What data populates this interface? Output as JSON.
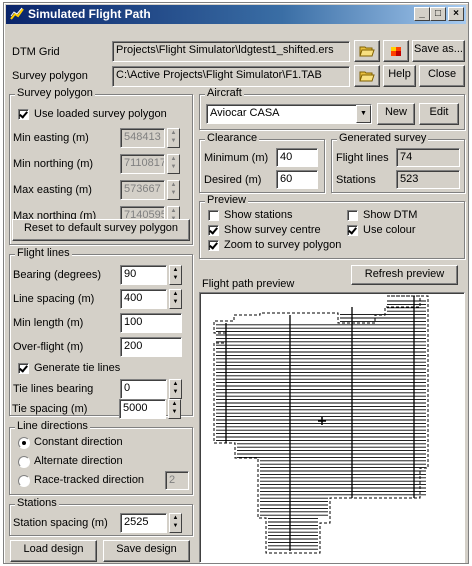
{
  "window": {
    "title": "Simulated Flight Path"
  },
  "dtm": {
    "label": "DTM Grid",
    "value": "Projects\\Flight Simulator\\ldgtest1_shifted.ers",
    "save_as": "Save as..."
  },
  "survey": {
    "label": "Survey polygon",
    "value": "C:\\Active Projects\\Flight Simulator\\F1.TAB",
    "help": "Help",
    "close": "Close"
  },
  "survey_polygon": {
    "title": "Survey polygon",
    "use_loaded": "Use loaded survey polygon",
    "min_easting_label": "Min easting (m)",
    "min_easting": "548413",
    "min_northing_label": "Min northing (m)",
    "min_northing": "7110817",
    "max_easting_label": "Max easting (m)",
    "max_easting": "573667",
    "max_northing_label": "Max northing (m)",
    "max_northing": "7140595",
    "reset": "Reset to default survey polygon"
  },
  "aircraft": {
    "title": "Aircraft",
    "selected": "Aviocar CASA",
    "new": "New",
    "edit": "Edit"
  },
  "clearance": {
    "title": "Clearance",
    "min_label": "Minimum  (m)",
    "min": "40",
    "des_label": "Desired  (m)",
    "des": "60"
  },
  "generated": {
    "title": "Generated survey",
    "lines_label": "Flight lines",
    "lines": "74",
    "stations_label": "Stations",
    "stations": "523"
  },
  "preview_opts": {
    "title": "Preview",
    "show_stations": "Show stations",
    "show_dtm": "Show DTM",
    "show_centre": "Show survey centre",
    "use_colour": "Use colour",
    "zoom": "Zoom to survey polygon"
  },
  "flight_lines": {
    "title": "Flight lines",
    "bearing_label": "Bearing (degrees)",
    "bearing": "90",
    "spacing_label": "Line spacing (m)",
    "spacing": "400",
    "minlen_label": "Min length (m)",
    "minlen": "100",
    "overflight_label": "Over-flight (m)",
    "overflight": "200",
    "tie_gen": "Generate tie lines",
    "tie_bearing_label": "Tie lines bearing",
    "tie_bearing": "0",
    "tie_spacing_label": "Tie spacing (m)",
    "tie_spacing": "5000"
  },
  "line_dir": {
    "title": "Line directions",
    "constant": "Constant direction",
    "alternate": "Alternate direction",
    "race": "Race-tracked direction",
    "race_value": "2"
  },
  "stations": {
    "title": "Stations",
    "spacing_label": "Station spacing (m)",
    "spacing": "2525"
  },
  "buttons": {
    "load": "Load design",
    "save": "Save design",
    "refresh": "Refresh preview"
  },
  "preview_title": "Flight path preview",
  "icons": {
    "app": "flight-path-icon",
    "open_dtm": "folder-open-icon",
    "color_dtm": "color-grid-icon",
    "open_survey": "folder-open-icon"
  }
}
